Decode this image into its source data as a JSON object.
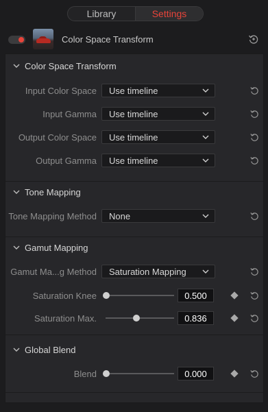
{
  "tabs": {
    "library": "Library",
    "settings": "Settings"
  },
  "header": {
    "title": "Color Space Transform",
    "enabled": true
  },
  "sections": {
    "cst": {
      "title": "Color Space Transform",
      "rows": [
        {
          "label": "Input Color Space",
          "value": "Use timeline"
        },
        {
          "label": "Input Gamma",
          "value": "Use timeline"
        },
        {
          "label": "Output Color Space",
          "value": "Use timeline"
        },
        {
          "label": "Output Gamma",
          "value": "Use timeline"
        }
      ]
    },
    "tone": {
      "title": "Tone Mapping",
      "rows": [
        {
          "label": "Tone Mapping Method",
          "value": "None"
        }
      ]
    },
    "gamut": {
      "title": "Gamut Mapping",
      "method": {
        "label": "Gamut Ma...g Method",
        "value": "Saturation Mapping"
      },
      "knee": {
        "label": "Saturation Knee",
        "value": "0.500",
        "position": 0.0
      },
      "max": {
        "label": "Saturation Max.",
        "value": "0.836",
        "position": 0.47
      }
    },
    "blend": {
      "title": "Global Blend",
      "blend": {
        "label": "Blend",
        "value": "0.000",
        "position": 0.0
      }
    }
  },
  "colors": {
    "accent": "#e8443a",
    "panel": "#27272a",
    "background": "#1c1c1e"
  },
  "icons": {
    "reset": "reset-arrow-icon",
    "keyframe": "keyframe-diamond-icon",
    "collapse": "chevron-down-icon"
  }
}
